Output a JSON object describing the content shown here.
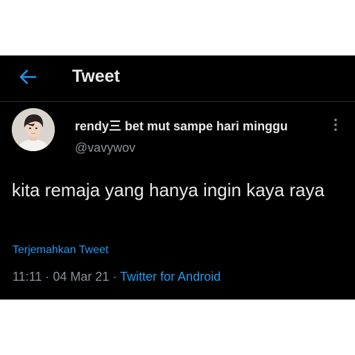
{
  "topbar": {
    "title": "Tweet"
  },
  "tweet": {
    "display_name": "rendy三 bet mut sampe hari minggu",
    "handle": "@vavywov",
    "text": "kita remaja yang hanya ingin kaya raya",
    "translate_label": "Terjemahkan Tweet",
    "time": "11:11",
    "separator": "·",
    "date": "04 Mar 21",
    "source": "Twitter for Android"
  },
  "colors": {
    "background": "#000000",
    "text": "#e7e9ea",
    "secondary_text": "#8b9196",
    "accent": "#1d9bf0"
  },
  "icons": {
    "back": "arrow-left-icon",
    "more": "more-vertical-icon"
  }
}
